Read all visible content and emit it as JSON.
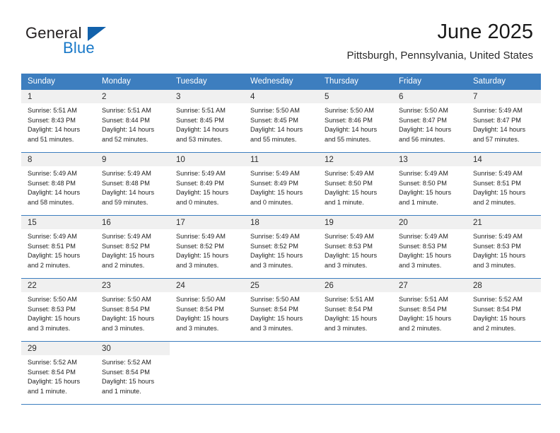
{
  "brand": {
    "name_part1": "General",
    "name_part2": "Blue"
  },
  "header": {
    "title": "June 2025",
    "subtitle": "Pittsburgh, Pennsylvania, United States"
  },
  "colors": {
    "header_blue": "#3d7ebf",
    "band_gray": "#f0f0f0",
    "brand_blue": "#1878c8",
    "triangle_blue": "#1261ab"
  },
  "weekdays": [
    "Sunday",
    "Monday",
    "Tuesday",
    "Wednesday",
    "Thursday",
    "Friday",
    "Saturday"
  ],
  "weeks": [
    [
      {
        "day": "1",
        "sunrise": "Sunrise: 5:51 AM",
        "sunset": "Sunset: 8:43 PM",
        "daylight_1": "Daylight: 14 hours",
        "daylight_2": "and 51 minutes."
      },
      {
        "day": "2",
        "sunrise": "Sunrise: 5:51 AM",
        "sunset": "Sunset: 8:44 PM",
        "daylight_1": "Daylight: 14 hours",
        "daylight_2": "and 52 minutes."
      },
      {
        "day": "3",
        "sunrise": "Sunrise: 5:51 AM",
        "sunset": "Sunset: 8:45 PM",
        "daylight_1": "Daylight: 14 hours",
        "daylight_2": "and 53 minutes."
      },
      {
        "day": "4",
        "sunrise": "Sunrise: 5:50 AM",
        "sunset": "Sunset: 8:45 PM",
        "daylight_1": "Daylight: 14 hours",
        "daylight_2": "and 55 minutes."
      },
      {
        "day": "5",
        "sunrise": "Sunrise: 5:50 AM",
        "sunset": "Sunset: 8:46 PM",
        "daylight_1": "Daylight: 14 hours",
        "daylight_2": "and 55 minutes."
      },
      {
        "day": "6",
        "sunrise": "Sunrise: 5:50 AM",
        "sunset": "Sunset: 8:47 PM",
        "daylight_1": "Daylight: 14 hours",
        "daylight_2": "and 56 minutes."
      },
      {
        "day": "7",
        "sunrise": "Sunrise: 5:49 AM",
        "sunset": "Sunset: 8:47 PM",
        "daylight_1": "Daylight: 14 hours",
        "daylight_2": "and 57 minutes."
      }
    ],
    [
      {
        "day": "8",
        "sunrise": "Sunrise: 5:49 AM",
        "sunset": "Sunset: 8:48 PM",
        "daylight_1": "Daylight: 14 hours",
        "daylight_2": "and 58 minutes."
      },
      {
        "day": "9",
        "sunrise": "Sunrise: 5:49 AM",
        "sunset": "Sunset: 8:48 PM",
        "daylight_1": "Daylight: 14 hours",
        "daylight_2": "and 59 minutes."
      },
      {
        "day": "10",
        "sunrise": "Sunrise: 5:49 AM",
        "sunset": "Sunset: 8:49 PM",
        "daylight_1": "Daylight: 15 hours",
        "daylight_2": "and 0 minutes."
      },
      {
        "day": "11",
        "sunrise": "Sunrise: 5:49 AM",
        "sunset": "Sunset: 8:49 PM",
        "daylight_1": "Daylight: 15 hours",
        "daylight_2": "and 0 minutes."
      },
      {
        "day": "12",
        "sunrise": "Sunrise: 5:49 AM",
        "sunset": "Sunset: 8:50 PM",
        "daylight_1": "Daylight: 15 hours",
        "daylight_2": "and 1 minute."
      },
      {
        "day": "13",
        "sunrise": "Sunrise: 5:49 AM",
        "sunset": "Sunset: 8:50 PM",
        "daylight_1": "Daylight: 15 hours",
        "daylight_2": "and 1 minute."
      },
      {
        "day": "14",
        "sunrise": "Sunrise: 5:49 AM",
        "sunset": "Sunset: 8:51 PM",
        "daylight_1": "Daylight: 15 hours",
        "daylight_2": "and 2 minutes."
      }
    ],
    [
      {
        "day": "15",
        "sunrise": "Sunrise: 5:49 AM",
        "sunset": "Sunset: 8:51 PM",
        "daylight_1": "Daylight: 15 hours",
        "daylight_2": "and 2 minutes."
      },
      {
        "day": "16",
        "sunrise": "Sunrise: 5:49 AM",
        "sunset": "Sunset: 8:52 PM",
        "daylight_1": "Daylight: 15 hours",
        "daylight_2": "and 2 minutes."
      },
      {
        "day": "17",
        "sunrise": "Sunrise: 5:49 AM",
        "sunset": "Sunset: 8:52 PM",
        "daylight_1": "Daylight: 15 hours",
        "daylight_2": "and 3 minutes."
      },
      {
        "day": "18",
        "sunrise": "Sunrise: 5:49 AM",
        "sunset": "Sunset: 8:52 PM",
        "daylight_1": "Daylight: 15 hours",
        "daylight_2": "and 3 minutes."
      },
      {
        "day": "19",
        "sunrise": "Sunrise: 5:49 AM",
        "sunset": "Sunset: 8:53 PM",
        "daylight_1": "Daylight: 15 hours",
        "daylight_2": "and 3 minutes."
      },
      {
        "day": "20",
        "sunrise": "Sunrise: 5:49 AM",
        "sunset": "Sunset: 8:53 PM",
        "daylight_1": "Daylight: 15 hours",
        "daylight_2": "and 3 minutes."
      },
      {
        "day": "21",
        "sunrise": "Sunrise: 5:49 AM",
        "sunset": "Sunset: 8:53 PM",
        "daylight_1": "Daylight: 15 hours",
        "daylight_2": "and 3 minutes."
      }
    ],
    [
      {
        "day": "22",
        "sunrise": "Sunrise: 5:50 AM",
        "sunset": "Sunset: 8:53 PM",
        "daylight_1": "Daylight: 15 hours",
        "daylight_2": "and 3 minutes."
      },
      {
        "day": "23",
        "sunrise": "Sunrise: 5:50 AM",
        "sunset": "Sunset: 8:54 PM",
        "daylight_1": "Daylight: 15 hours",
        "daylight_2": "and 3 minutes."
      },
      {
        "day": "24",
        "sunrise": "Sunrise: 5:50 AM",
        "sunset": "Sunset: 8:54 PM",
        "daylight_1": "Daylight: 15 hours",
        "daylight_2": "and 3 minutes."
      },
      {
        "day": "25",
        "sunrise": "Sunrise: 5:50 AM",
        "sunset": "Sunset: 8:54 PM",
        "daylight_1": "Daylight: 15 hours",
        "daylight_2": "and 3 minutes."
      },
      {
        "day": "26",
        "sunrise": "Sunrise: 5:51 AM",
        "sunset": "Sunset: 8:54 PM",
        "daylight_1": "Daylight: 15 hours",
        "daylight_2": "and 3 minutes."
      },
      {
        "day": "27",
        "sunrise": "Sunrise: 5:51 AM",
        "sunset": "Sunset: 8:54 PM",
        "daylight_1": "Daylight: 15 hours",
        "daylight_2": "and 2 minutes."
      },
      {
        "day": "28",
        "sunrise": "Sunrise: 5:52 AM",
        "sunset": "Sunset: 8:54 PM",
        "daylight_1": "Daylight: 15 hours",
        "daylight_2": "and 2 minutes."
      }
    ],
    [
      {
        "day": "29",
        "sunrise": "Sunrise: 5:52 AM",
        "sunset": "Sunset: 8:54 PM",
        "daylight_1": "Daylight: 15 hours",
        "daylight_2": "and 1 minute."
      },
      {
        "day": "30",
        "sunrise": "Sunrise: 5:52 AM",
        "sunset": "Sunset: 8:54 PM",
        "daylight_1": "Daylight: 15 hours",
        "daylight_2": "and 1 minute."
      },
      {
        "day": "",
        "sunrise": "",
        "sunset": "",
        "daylight_1": "",
        "daylight_2": ""
      },
      {
        "day": "",
        "sunrise": "",
        "sunset": "",
        "daylight_1": "",
        "daylight_2": ""
      },
      {
        "day": "",
        "sunrise": "",
        "sunset": "",
        "daylight_1": "",
        "daylight_2": ""
      },
      {
        "day": "",
        "sunrise": "",
        "sunset": "",
        "daylight_1": "",
        "daylight_2": ""
      },
      {
        "day": "",
        "sunrise": "",
        "sunset": "",
        "daylight_1": "",
        "daylight_2": ""
      }
    ]
  ]
}
